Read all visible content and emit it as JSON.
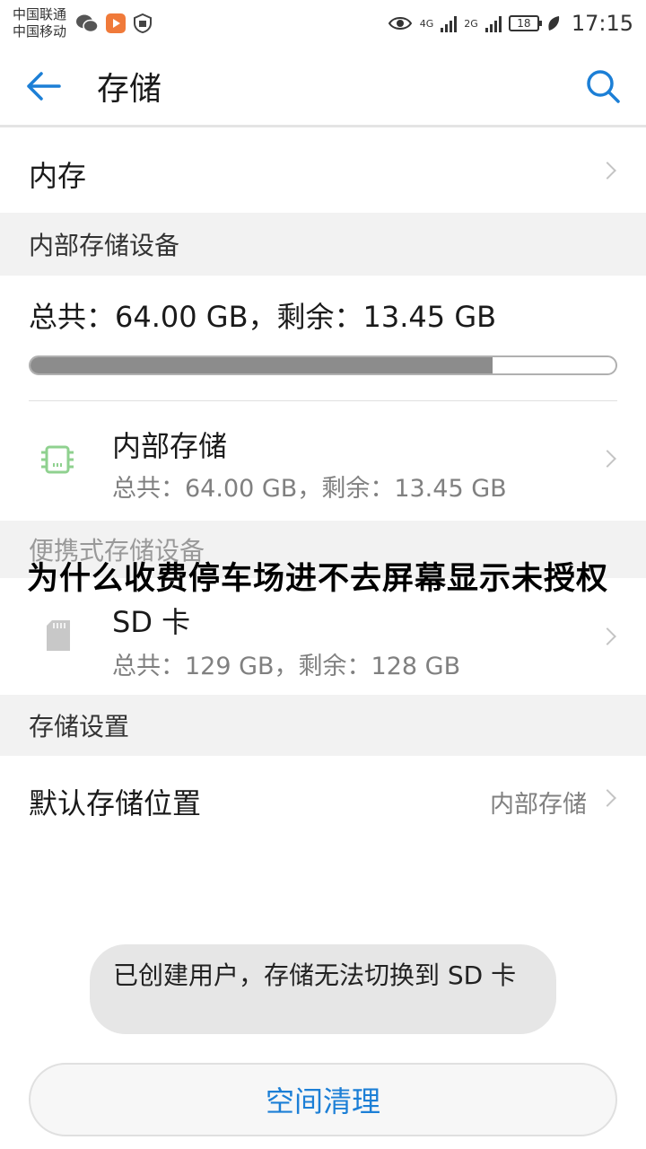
{
  "status_bar": {
    "carrier_1": "中国联通",
    "carrier_2": "中国移动",
    "network_1": "4G",
    "network_2": "2G",
    "battery": "18",
    "time": "17:15"
  },
  "header": {
    "title": "存储"
  },
  "memory_row": {
    "label": "内存"
  },
  "internal_section": {
    "header": "内部存储设备",
    "total_line": "总共：64.00 GB，剩余：13.45 GB",
    "usage_fraction": 0.79,
    "item": {
      "title": "内部存储",
      "subtitle": "总共：64.00 GB，剩余：13.45 GB"
    }
  },
  "portable_section": {
    "header": "便携式存储设备",
    "item": {
      "title": "SD 卡",
      "subtitle": "总共：129 GB，剩余：128 GB"
    }
  },
  "settings_section": {
    "header": "存储设置",
    "default_location_label": "默认存储位置",
    "default_location_value": "内部存储"
  },
  "overlay_title": "为什么收费停车场进不去屏幕显示未授权",
  "toast": "已创建用户，存储无法切换到 SD 卡",
  "clean_button": "空间清理",
  "colors": {
    "accent": "#1c7fd6",
    "chip_icon": "#8fd18f"
  }
}
